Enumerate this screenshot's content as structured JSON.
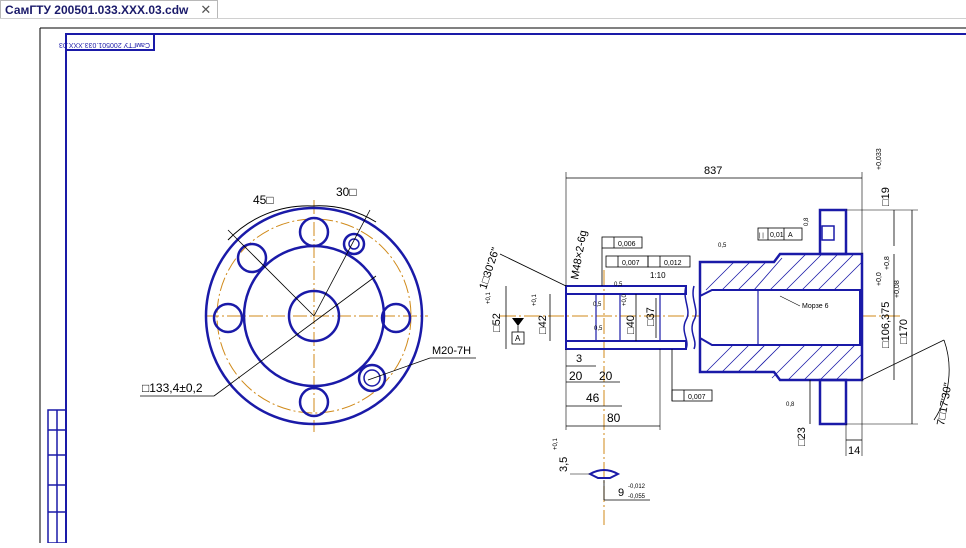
{
  "tab": {
    "title": "СамГТУ 200501.033.XXX.03.cdw",
    "close_glyph": "✕"
  },
  "drawing": {
    "stamp_text": "СамГТУ 200501.033.XXX.03",
    "flange_view": {
      "angle_45": "45□",
      "angle_30": "30□",
      "thread_label": "М20-7Н",
      "bolt_circle": "□133,4±0,2"
    },
    "section_view": {
      "dim_837": "837",
      "dim_19": "□19",
      "dim_19_tol": "+0,033",
      "dim_106": "□106,375",
      "dim_106_tol_a": "+0,0",
      "dim_106_tol_b": "+0,8",
      "dim_170": "□170",
      "dim_170_tol": "+0,08",
      "dim_23": "□23",
      "dim_14": "14",
      "dim_52": "□52",
      "dim_52_tol": "+0,1",
      "dim_42": "□42",
      "dim_42_tol": "+0,1",
      "dim_40": "□40",
      "dim_40_tol": "+0,0",
      "dim_37": "□37",
      "dim_3": "3",
      "dim_20a": "20",
      "dim_20b": "20",
      "dim_46": "46",
      "dim_80": "80",
      "dim_35": "3,5",
      "dim_35_tol": "+0,1",
      "dim_9": "9",
      "dim_9_tol_a": "-0,012",
      "dim_9_tol_b": "-0,055",
      "thread_m48": "М48×2-6g",
      "angle_left": "1□30'26\"",
      "angle_right": "7□17'30\"",
      "taper": "1:10",
      "morse": "Морзе 6",
      "datum": "А",
      "tol_006": "0,006",
      "tol_007a": "0,007",
      "tol_012": "0,012",
      "tol_007b": "0,007",
      "tol_001": "0,01",
      "frame_sym": "|  |",
      "rough_05a": "0,5",
      "rough_08a": "0,8",
      "rough_05b": "0,5",
      "rough_05c": "0,5",
      "rough_08b": "0,8",
      "rough_05d": "0,5"
    }
  },
  "colors": {
    "ink": "#1a1aa8",
    "axis": "#d08a1a",
    "black": "#000000",
    "tab_text": "#1a1a6a"
  }
}
